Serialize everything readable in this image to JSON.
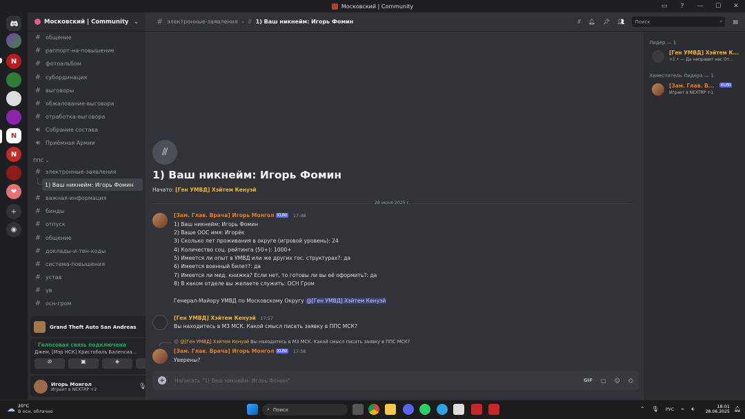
{
  "window": {
    "title": "Московский | Community",
    "controls": [
      "monitor-icon",
      "help-icon",
      "minimize",
      "maximize",
      "close"
    ]
  },
  "guild": {
    "name": "Московский | Community"
  },
  "channels": [
    {
      "name": "общение",
      "type": "text"
    },
    {
      "name": "раппорт-на-повышение",
      "type": "text"
    },
    {
      "name": "фотоальбом",
      "type": "text"
    },
    {
      "name": "субординация",
      "type": "text"
    },
    {
      "name": "выговоры",
      "type": "text"
    },
    {
      "name": "обжалование-выговора",
      "type": "text"
    },
    {
      "name": "отработка-выговора",
      "type": "text"
    },
    {
      "name": "Собрание состава",
      "type": "voice"
    },
    {
      "name": "Приёмная Армии",
      "type": "voice"
    }
  ],
  "category": {
    "name": "ППС"
  },
  "pps_channels": [
    {
      "name": "электронные-заявления",
      "type": "text"
    },
    {
      "name": "1) Ваш никнейм: Игорь Фомин",
      "type": "thread",
      "active": true
    },
    {
      "name": "важная-информация",
      "type": "text"
    },
    {
      "name": "бинды",
      "type": "text"
    },
    {
      "name": "отпуск",
      "type": "text"
    },
    {
      "name": "общение",
      "type": "text"
    },
    {
      "name": "доклады-и-тен-коды",
      "type": "text"
    },
    {
      "name": "система-повышения",
      "type": "text"
    },
    {
      "name": "устав",
      "type": "text"
    },
    {
      "name": "ув",
      "type": "text"
    },
    {
      "name": "осн-гром",
      "type": "text"
    }
  ],
  "activity": {
    "game": "Grand Theft Auto San Andreas"
  },
  "voice": {
    "status": "Голосовая связь подключена",
    "channel": "Джем, [Мэр НСК] Кристобаль Баленсиа..."
  },
  "user": {
    "name": "Игорь Монгол",
    "status": "Играет в NEXTRP +2"
  },
  "topbar": {
    "parent": "электронные-заявления",
    "thread": "1) Ваш никнейм: Игорь Фомин",
    "search_placeholder": "Поиск"
  },
  "thread_header": {
    "title": "1) Ваш никнейм: Игорь Фомин",
    "started_label": "Начато:",
    "started_by": "[Ген УМВД] Хэйтем Кенуэй"
  },
  "date_divider": "28 июня 2025 г.",
  "messages": [
    {
      "author": "[Зам. Глав. Врача] Игорь Монгол",
      "tag": "KUNI",
      "time": "17:48",
      "lines": [
        "1) Ваш никнейм: Игорь Фомин",
        "2) Ваше ООС имя: Игорёк",
        "3) Сколько лет проживания в округе (игровой уровень): 24",
        "4) Количество соц. рейтинга (50+): 1000+",
        "5) Имеется ли опыт в УМВД или же других гос. структурах?: да",
        "6) Имеется военный билет?: да",
        "7) Имеется ли мед. книжка? Если нет, то готовы ли вы её оформить?: да",
        "8) В каком отделе вы желаете служить: ОСН Гром"
      ],
      "footer_text": "Генерал-Майору УМВД по Московскому Округу",
      "footer_mention": "@[Ген УМВД] Хэйтем Кенуэй"
    },
    {
      "author": "[Ген УМВД] Хэйтем Кенуэй",
      "time": "17:57",
      "text": "Вы находитесь в МЗ МСК. Какой смысл писать заявку в ППС МСК?"
    },
    {
      "reply_author": "@[Ген УМВД] Хэйтем Кенуэй",
      "reply_text": "Вы находитесь в МЗ МСК. Какой смысл писать заявку в ППС МСК?",
      "author": "[Зам. Глав. Врача] Игорь Монгол",
      "tag": "KUNI",
      "time": "17:58",
      "text": "Уверены?"
    }
  ],
  "composer": {
    "placeholder": "Написать \"1) Ваш никнейм: Игорь Фомин\""
  },
  "members": {
    "groups": [
      {
        "title": "Лидер — 1",
        "name": "[Ген УМВД] Хэйтем К...",
        "status": "+1 • — Да направит нас От..."
      },
      {
        "title": "Заместитель Лидера — 1",
        "name": "[Зам. Глав. В...",
        "tag": "KUNI",
        "status": "Играет в NEXTRP +1"
      }
    ]
  },
  "taskbar": {
    "weather_temp": "20°C",
    "weather_desc": "В осн. облачно",
    "search": "Поиск",
    "lang": "РУС",
    "time": "18:01",
    "date": "28.06.2025"
  },
  "colors": {
    "accent": "#5865f2",
    "role_gold": "#f0b232",
    "role_orange": "#e67e22",
    "online": "#23a55a"
  }
}
